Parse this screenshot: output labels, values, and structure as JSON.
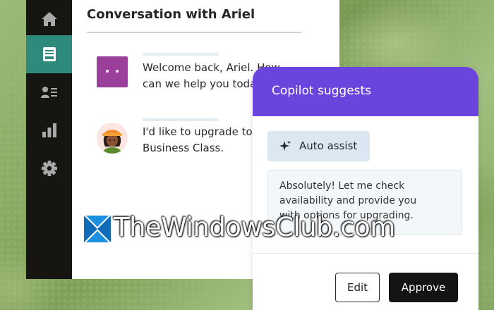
{
  "sidebar": {
    "items": [
      {
        "icon": "home-icon",
        "active": false
      },
      {
        "icon": "inbox-icon",
        "active": true
      },
      {
        "icon": "contacts-icon",
        "active": false
      },
      {
        "icon": "analytics-icon",
        "active": false
      },
      {
        "icon": "gear-icon",
        "active": false
      }
    ],
    "colors": {
      "background": "#171512",
      "active": "#2e8b7c"
    }
  },
  "conversation": {
    "title": "Conversation with Ariel",
    "messages": [
      {
        "sender": "bot",
        "avatar": "bot-avatar",
        "lines": [
          "Welcome back, Ariel. How",
          "can we help you toda"
        ]
      },
      {
        "sender": "user",
        "avatar": "user-avatar",
        "lines": [
          "I'd like to upgrade to",
          "Business Class."
        ]
      }
    ]
  },
  "copilot": {
    "title": "Copilot suggests",
    "accent": "#6b44dd",
    "auto_assist_label": "Auto assist",
    "suggestion_lines": [
      "Absolutely! Let me check",
      "availability and provide you",
      "with options for upgrading."
    ],
    "edit_label": "Edit",
    "approve_label": "Approve"
  },
  "watermark": {
    "text": "TheWindowsClub.com"
  }
}
